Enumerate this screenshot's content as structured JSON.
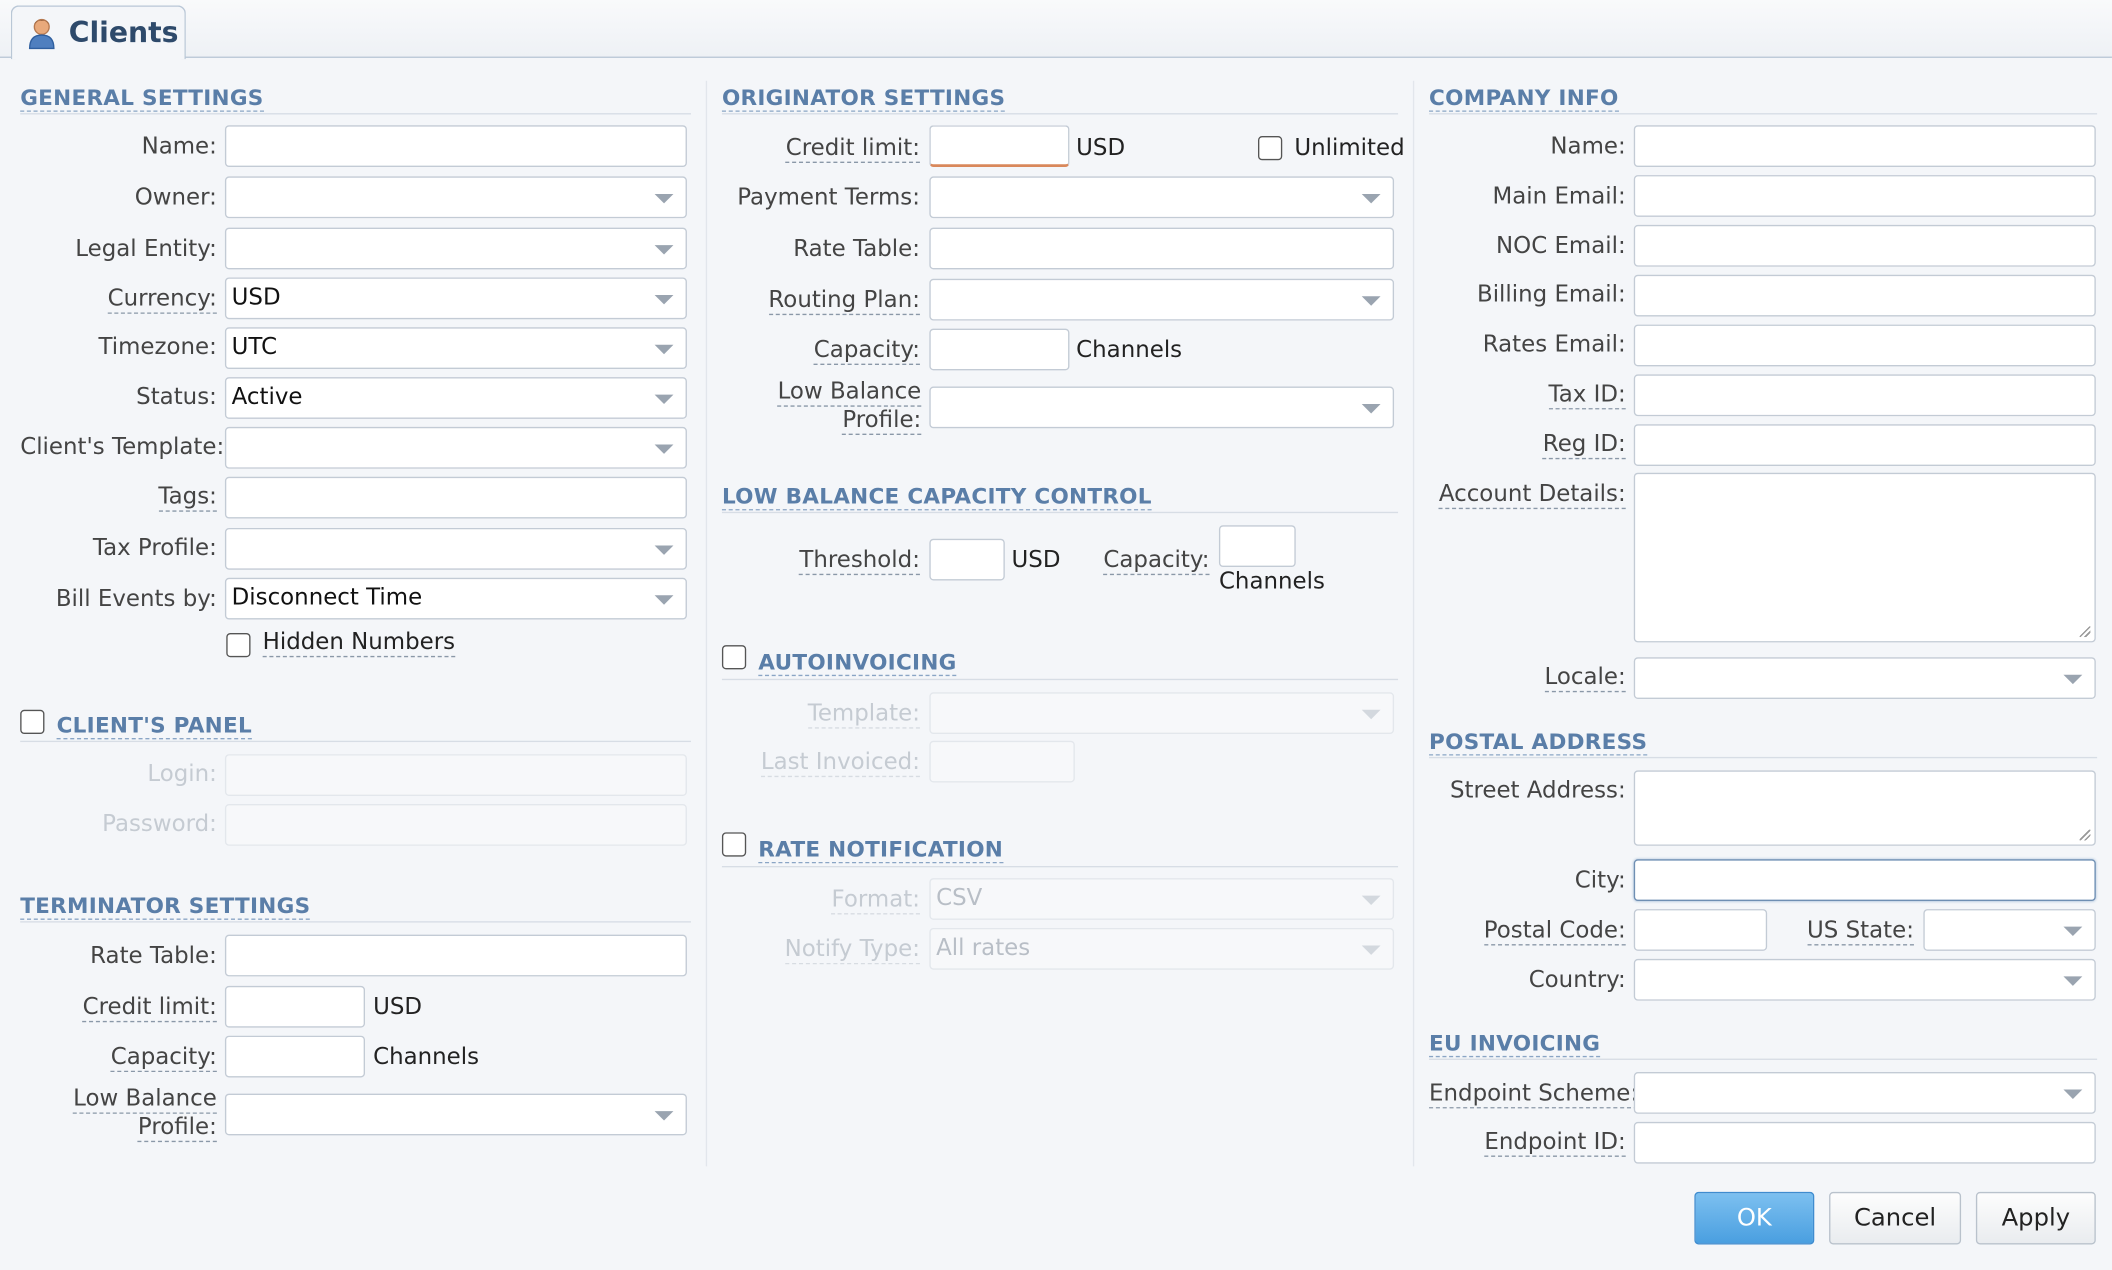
{
  "tab": {
    "title": "Clients",
    "icon": "user-icon"
  },
  "general": {
    "title": "GENERAL SETTINGS",
    "name_label": "Name:",
    "owner_label": "Owner:",
    "legal_label": "Legal Entity:",
    "currency_label": "Currency:",
    "currency_value": "USD",
    "timezone_label": "Timezone:",
    "timezone_value": "UTC",
    "status_label": "Status:",
    "status_value": "Active",
    "template_label": "Client's Template:",
    "tags_label": "Tags:",
    "tax_label": "Tax Profile:",
    "bill_label": "Bill Events by:",
    "bill_value": "Disconnect Time",
    "hidden_label": "Hidden Numbers"
  },
  "panel": {
    "title": "CLIENT'S PANEL",
    "login_label": "Login:",
    "password_label": "Password:"
  },
  "terminator": {
    "title": "TERMINATOR SETTINGS",
    "rate_label": "Rate Table:",
    "credit_label": "Credit limit:",
    "credit_unit": "USD",
    "capacity_label": "Capacity:",
    "capacity_unit": "Channels",
    "lowbal_label_1": "Low Balance",
    "lowbal_label_2": "Profile:"
  },
  "originator": {
    "title": "ORIGINATOR SETTINGS",
    "credit_label": "Credit limit:",
    "credit_unit": "USD",
    "unlimited_label": "Unlimited",
    "payment_label": "Payment Terms:",
    "rate_label": "Rate Table:",
    "routing_label": "Routing Plan:",
    "capacity_label": "Capacity:",
    "capacity_unit": "Channels",
    "lowbal_label_1": "Low Balance",
    "lowbal_label_2": "Profile:"
  },
  "lowcap": {
    "title": "LOW BALANCE CAPACITY CONTROL",
    "threshold_label": "Threshold:",
    "threshold_unit": "USD",
    "capacity_label": "Capacity:",
    "capacity_unit": "Channels"
  },
  "autoinv": {
    "title": "AUTOINVOICING",
    "template_label": "Template:",
    "last_label": "Last Invoiced:"
  },
  "ratenotif": {
    "title": "RATE NOTIFICATION",
    "format_label": "Format:",
    "format_value": "CSV",
    "notify_label": "Notify Type:",
    "notify_value": "All rates"
  },
  "company": {
    "title": "COMPANY INFO",
    "name_label": "Name:",
    "main_email_label": "Main Email:",
    "noc_email_label": "NOC Email:",
    "billing_email_label": "Billing Email:",
    "rates_email_label": "Rates Email:",
    "taxid_label": "Tax ID:",
    "regid_label": "Reg ID:",
    "account_label": "Account Details:",
    "locale_label": "Locale:"
  },
  "postal": {
    "title": "POSTAL ADDRESS",
    "street_label": "Street Address:",
    "city_label": "City:",
    "postal_label": "Postal Code:",
    "state_label": "US State:",
    "country_label": "Country:"
  },
  "eu": {
    "title": "EU INVOICING",
    "scheme_label": "Endpoint Scheme:",
    "endpoint_label": "Endpoint ID:"
  },
  "buttons": {
    "ok": "OK",
    "cancel": "Cancel",
    "apply": "Apply"
  }
}
